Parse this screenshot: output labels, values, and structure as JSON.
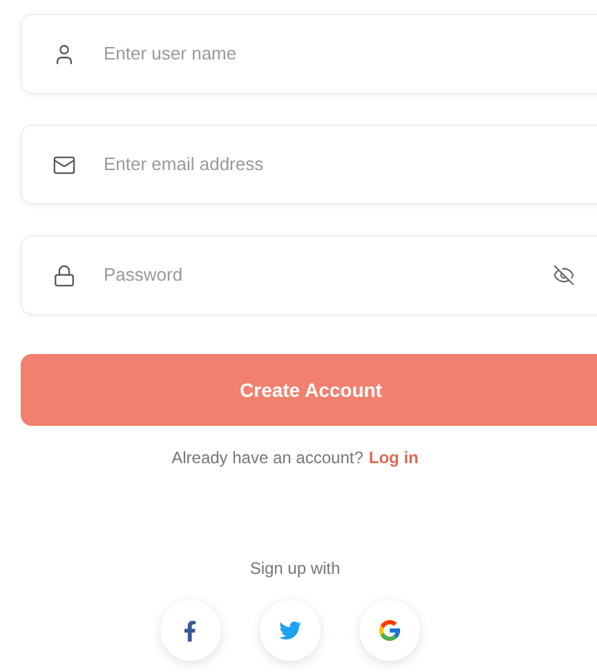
{
  "fields": [
    {
      "kind": "user",
      "placeholder": "Enter user name"
    },
    {
      "kind": "email",
      "placeholder": "Enter email address"
    },
    {
      "kind": "password",
      "placeholder": "Password",
      "reveal": false
    }
  ],
  "submit": "Create Account",
  "login_prompt": {
    "text": "Already have an account?",
    "link": "Log in"
  },
  "social": {
    "label": "Sign up with",
    "buttons": [
      {
        "kind": "facebook"
      },
      {
        "kind": "twitter"
      },
      {
        "kind": "google"
      }
    ]
  }
}
